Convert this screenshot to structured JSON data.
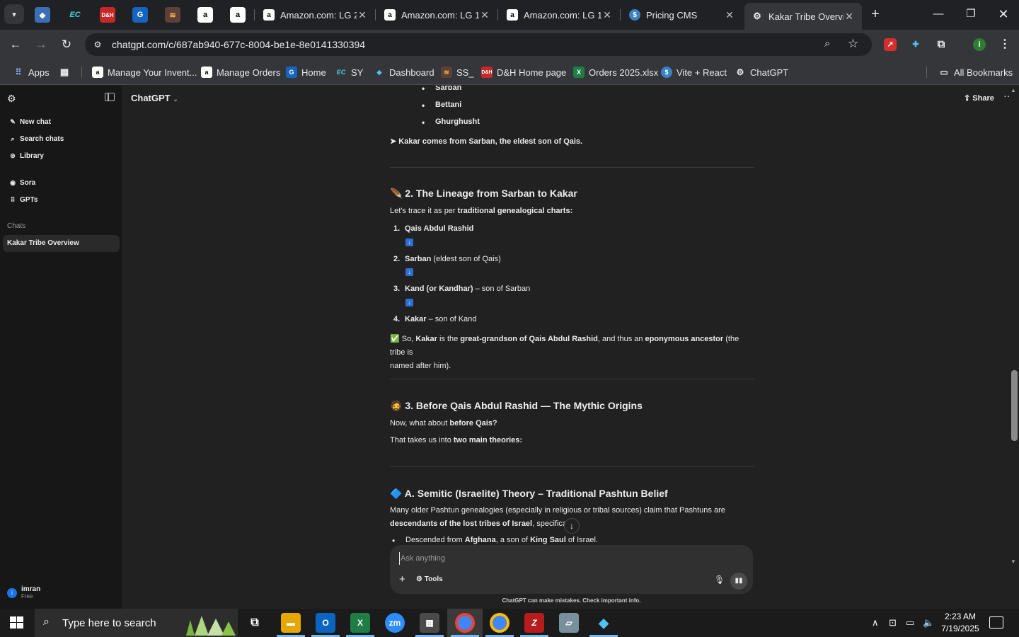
{
  "browser": {
    "tabs": [
      {
        "title": "Amazon.com: LG 2",
        "icon": "amazon-icon"
      },
      {
        "title": "Amazon.com: LG 1",
        "icon": "amazon-icon"
      },
      {
        "title": "Amazon.com: LG 1",
        "icon": "amazon-icon"
      },
      {
        "title": "Pricing CMS",
        "icon": "dollar-icon"
      },
      {
        "title": "Kakar Tribe Overvi",
        "icon": "chatgpt-icon",
        "active": true
      }
    ],
    "pinned_tabs": [
      "ec",
      "pdf",
      "g",
      "stack",
      "a",
      "a"
    ],
    "url": "chatgpt.com/c/687ab940-677c-8004-be1e-8e0141330394",
    "bookmarks": [
      "Apps",
      "Manage Your Invent...",
      "Manage Orders",
      "Home",
      "SY",
      "Dashboard",
      "SS_",
      "D&H Home page",
      "Orders 2025.xlsx",
      "Vite + React",
      "ChatGPT"
    ],
    "all_bookmarks": "All Bookmarks",
    "profile_initial": "i"
  },
  "sidebar": {
    "new_chat": "New chat",
    "search_chats": "Search chats",
    "library": "Library",
    "sora": "Sora",
    "gpts": "GPTs",
    "chats_label": "Chats",
    "active_chat": "Kakar Tribe Overview",
    "user_name": "imran",
    "user_plan": "Free",
    "user_initial": "i"
  },
  "header": {
    "model": "ChatGPT",
    "share": "Share"
  },
  "message": {
    "list_top": [
      "Sarban",
      "Bettani",
      "Ghurghusht"
    ],
    "kakar_origin_pre": "➤ Kakar comes from ",
    "kakar_origin_sarban": "Sarban",
    "kakar_origin_post": ", the eldest son of Qais.",
    "section2_title": "🪶 2. The Lineage from Sarban to Kakar",
    "section2_intro_pre": "Let's trace it as per ",
    "section2_intro_bold": "traditional genealogical charts:",
    "lineage": [
      {
        "num": "1.",
        "name": "Qais Abdul Rashid",
        "rest": ""
      },
      {
        "num": "2.",
        "name": "Sarban",
        "rest": " (eldest son of Qais)"
      },
      {
        "num": "3.",
        "name": "Kand (or Kandhar)",
        "rest": " – son of Sarban"
      },
      {
        "num": "4.",
        "name": "Kakar",
        "rest": " – son of Kand"
      }
    ],
    "conclusion_1": "✅ So, ",
    "conclusion_kakar": "Kakar",
    "conclusion_2": " is the ",
    "conclusion_ggs": "great-grandson of Qais Abdul Rashid",
    "conclusion_3": ", and thus an ",
    "conclusion_ep": "eponymous ancestor",
    "conclusion_4": " (the tribe is",
    "conclusion_5": "named after him).",
    "section3_title": "🧔 3. Before Qais Abdul Rashid — The Mythic Origins",
    "section3_q_pre": "Now, what about ",
    "section3_q_bold": "before Qais?",
    "section3_t_pre": "That takes us into ",
    "section3_t_bold": "two main theories:",
    "sectionA_title": "🔷 A. Semitic (Israelite) Theory – Traditional Pashtun Belief",
    "sectionA_p1": "Many older Pashtun genealogies (especially in religious or tribal sources) claim that Pashtuns are",
    "sectionA_p2_bold": "descendants of the lost tribes of Israel",
    "sectionA_p2_rest": ", specifically:",
    "sectionA_bullet_pre": "Descended from ",
    "sectionA_bullet_b1": "Afghana",
    "sectionA_bullet_mid": ", a son of ",
    "sectionA_bullet_b2": "King Saul",
    "sectionA_bullet_post": " of Israel."
  },
  "composer": {
    "placeholder": "Ask anything",
    "tools": "Tools",
    "disclaimer": "ChatGPT can make mistakes. Check important info."
  },
  "taskbar": {
    "search_placeholder": "Type here to search",
    "time": "2:23 AM",
    "date": "7/19/2025"
  }
}
